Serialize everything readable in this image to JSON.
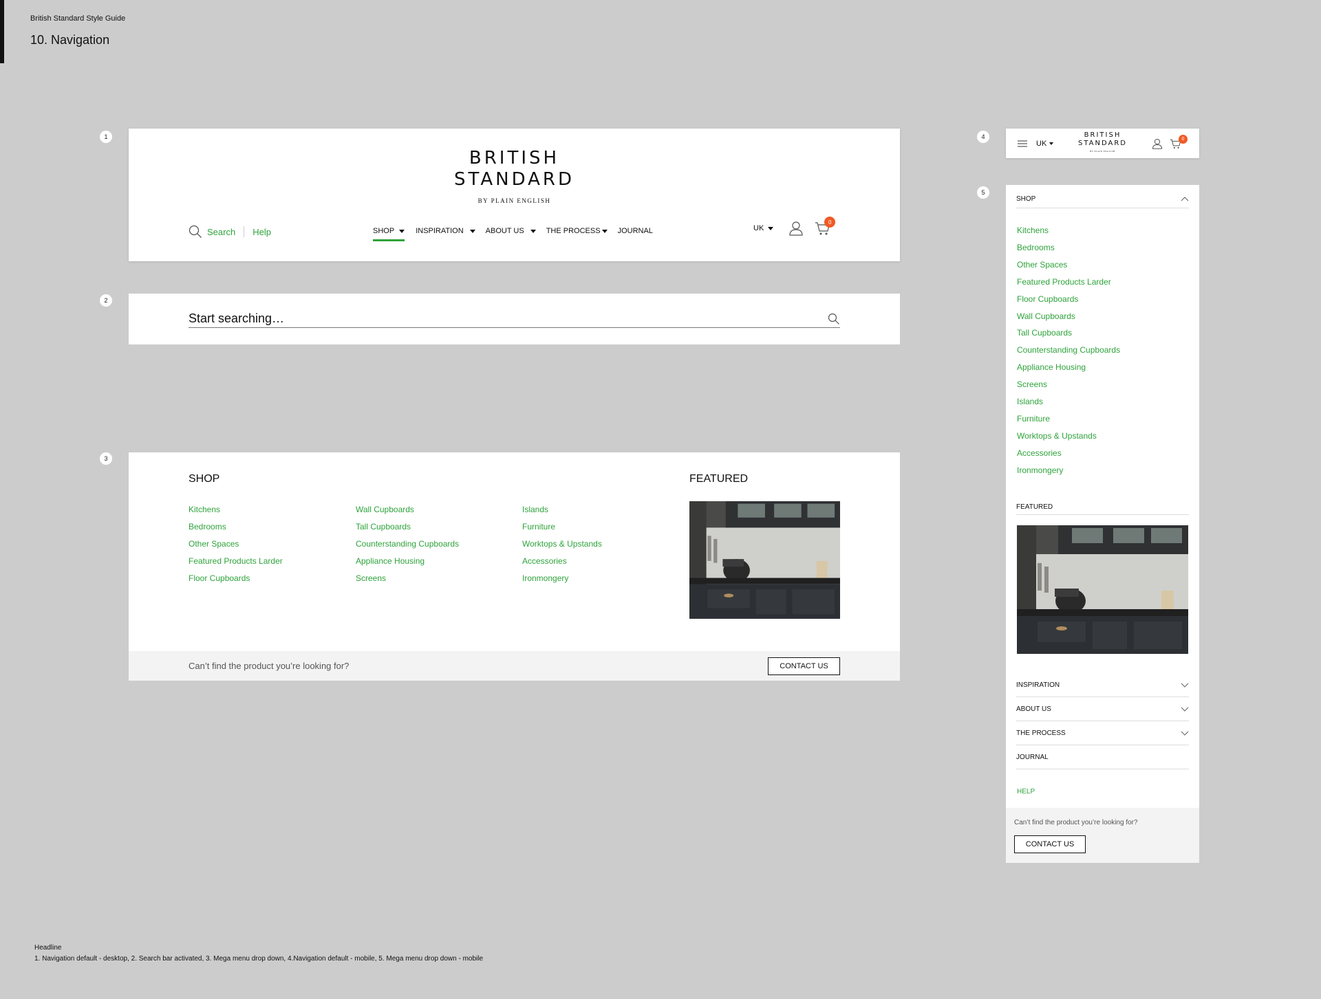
{
  "guide": {
    "title": "British Standard Style Guide",
    "heading": "10. Navigation"
  },
  "markers": [
    "1",
    "2",
    "3",
    "4",
    "5"
  ],
  "brand": {
    "line1": "BRITISH",
    "line2": "STANDARD",
    "sub": "BY PLAIN ENGLISH"
  },
  "desktop_nav": {
    "search_label": "Search",
    "help_label": "Help",
    "items": [
      "SHOP",
      "INSPIRATION",
      "ABOUT US",
      "THE PROCESS",
      "JOURNAL"
    ],
    "active_item": "SHOP",
    "region": "UK",
    "cart_count": "0"
  },
  "search_bar": {
    "placeholder": "Start searching…"
  },
  "mega_menu": {
    "shop_heading": "SHOP",
    "featured_heading": "FEATURED",
    "columns": [
      [
        "Kitchens",
        "Bedrooms",
        "Other Spaces",
        "Featured Products Larder",
        "Floor Cupboards"
      ],
      [
        "Wall Cupboards",
        "Tall Cupboards",
        "Counterstanding Cupboards",
        "Appliance Housing",
        "Screens"
      ],
      [
        "Islands",
        "Furniture",
        "Worktops & Upstands",
        "Accessories",
        "Ironmongery"
      ]
    ],
    "footer_text": "Can’t find the product you’re looking for?",
    "contact_label": "CONTACT US"
  },
  "mobile_nav": {
    "region": "UK",
    "cart_count": "0"
  },
  "mobile_menu": {
    "shop_heading": "SHOP",
    "shop_items": [
      "Kitchens",
      "Bedrooms",
      "Other Spaces",
      "Featured Products Larder",
      "Floor Cupboards",
      "Wall Cupboards",
      "Tall Cupboards",
      "Counterstanding Cupboards",
      "Appliance Housing",
      "Screens",
      "Islands",
      "Furniture",
      "Worktops & Upstands",
      "Accessories",
      "Ironmongery"
    ],
    "featured_heading": "FEATURED",
    "sections": [
      "INSPIRATION",
      "ABOUT US",
      "THE PROCESS",
      "JOURNAL"
    ],
    "help_label": "HELP",
    "footer_text": "Can’t find the product you’re looking for?",
    "contact_label": "CONTACT US"
  },
  "caption": {
    "title": "Headline",
    "text": "1. Navigation default - desktop, 2. Search bar activated, 3. Mega menu drop down, 4.Navigation default - mobile, 5. Mega menu drop down - mobile"
  },
  "colors": {
    "accent_green": "#2ea33b",
    "badge_orange": "#f15a24",
    "page_bg": "#cccccc"
  }
}
